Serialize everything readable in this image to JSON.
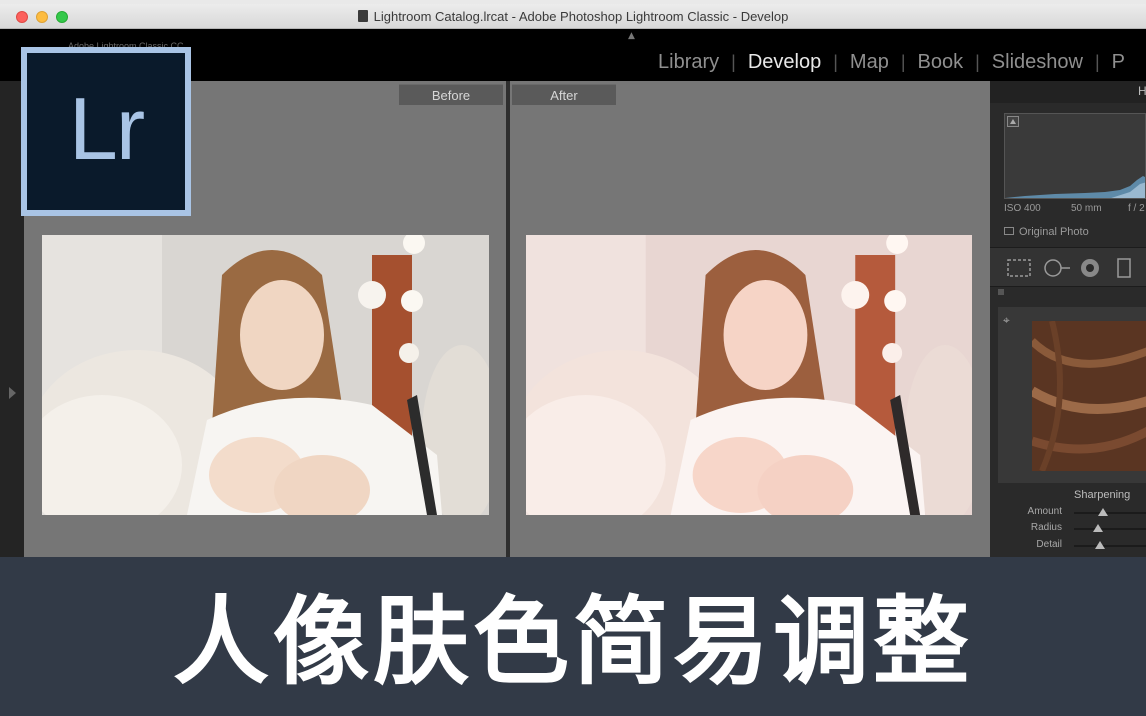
{
  "window": {
    "title": "Lightroom Catalog.lrcat - Adobe Photoshop Lightroom Classic - Develop"
  },
  "identity_plate": "Adobe Lightroom Classic CC",
  "logo": {
    "text": "Lr",
    "color": "#a9c4e5",
    "background": "#0a1a2b"
  },
  "modules": [
    {
      "label": "Library",
      "active": false
    },
    {
      "label": "Develop",
      "active": true
    },
    {
      "label": "Map",
      "active": false
    },
    {
      "label": "Book",
      "active": false
    },
    {
      "label": "Slideshow",
      "active": false
    },
    {
      "label": "P",
      "active": false
    }
  ],
  "compare": {
    "before_label": "Before",
    "after_label": "After"
  },
  "right_panel": {
    "header": "H",
    "iso": "ISO 400",
    "focal": "50 mm",
    "aperture": "f / 2",
    "original_photo": "Original Photo",
    "sharpening": {
      "title": "Sharpening",
      "sliders": [
        {
          "label": "Amount",
          "value": 0.4
        },
        {
          "label": "Radius",
          "value": 0.34
        },
        {
          "label": "Detail",
          "value": 0.36
        }
      ]
    }
  },
  "caption": "人像肤色简易调整"
}
